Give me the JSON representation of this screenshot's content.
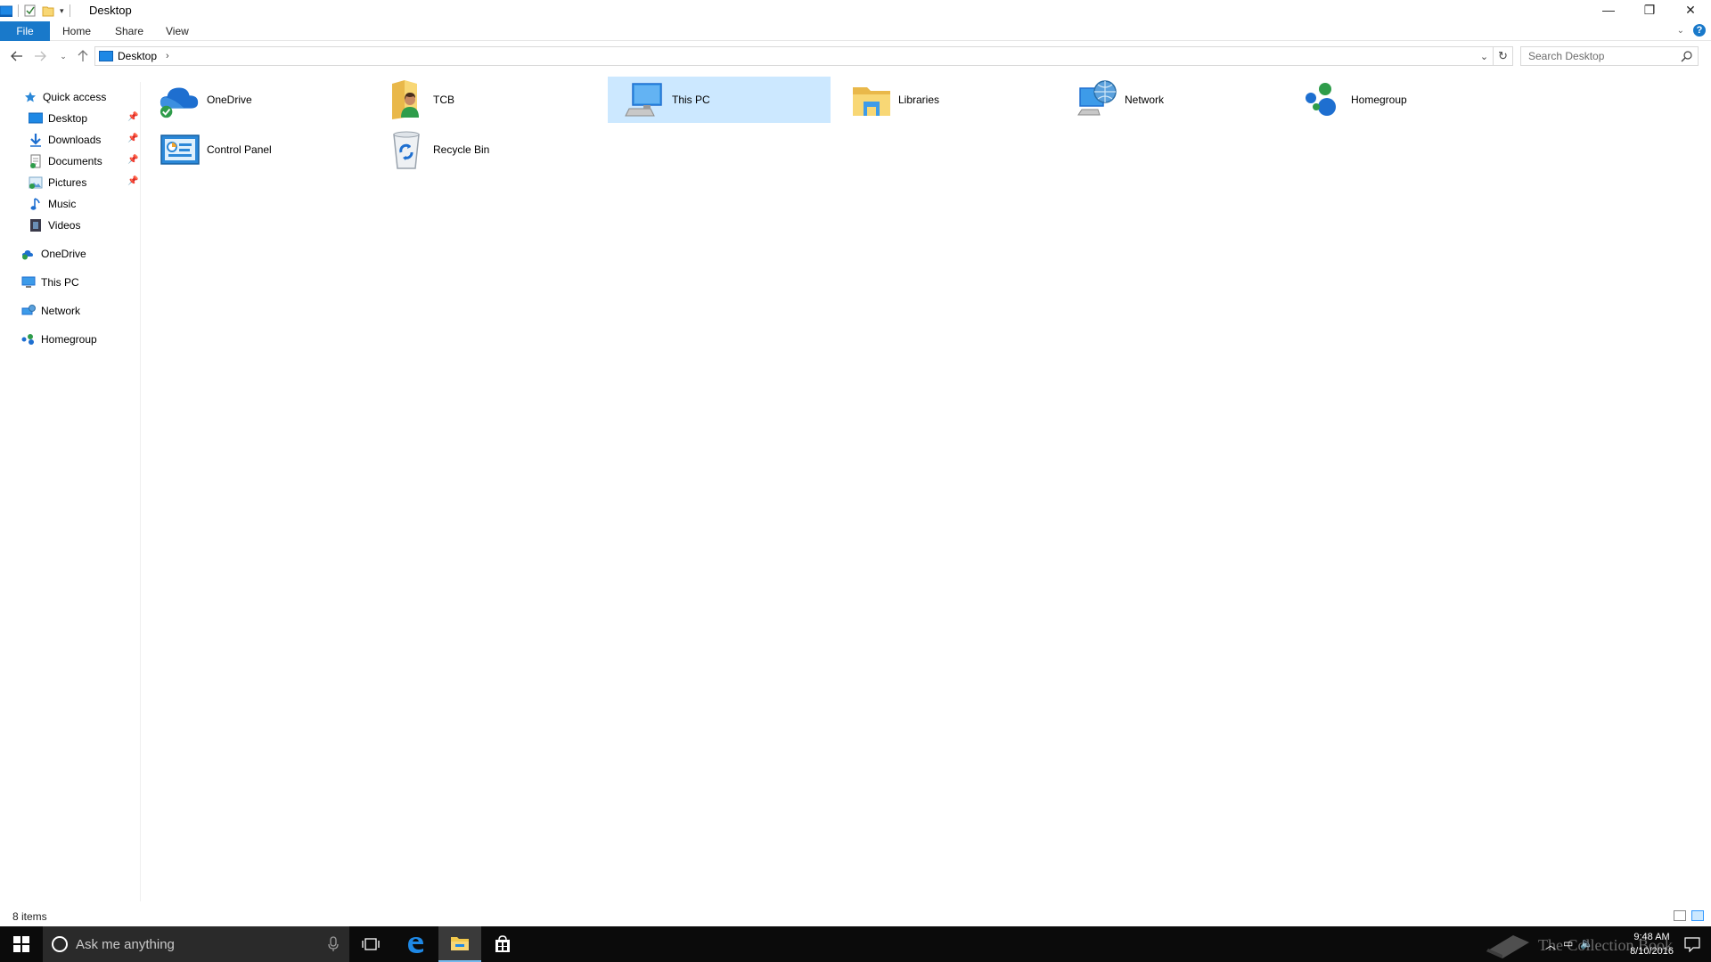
{
  "window": {
    "title": "Desktop",
    "controls": {
      "minimize": "—",
      "restore": "❐",
      "close": "✕"
    }
  },
  "ribbon": {
    "tabs": [
      {
        "label": "File"
      },
      {
        "label": "Home"
      },
      {
        "label": "Share"
      },
      {
        "label": "View"
      }
    ],
    "help": "?"
  },
  "address": {
    "location": "Desktop",
    "chevron": "›"
  },
  "search": {
    "placeholder": "Search Desktop"
  },
  "navpane": {
    "quick_access": "Quick access",
    "pinned": [
      {
        "label": "Desktop"
      },
      {
        "label": "Downloads"
      },
      {
        "label": "Documents"
      },
      {
        "label": "Pictures"
      }
    ],
    "unpinned": [
      {
        "label": "Music"
      },
      {
        "label": "Videos"
      }
    ],
    "roots": [
      {
        "label": "OneDrive"
      },
      {
        "label": "This PC"
      },
      {
        "label": "Network"
      },
      {
        "label": "Homegroup"
      }
    ]
  },
  "items": [
    {
      "label": "OneDrive",
      "icon": "onedrive-icon"
    },
    {
      "label": "TCB",
      "icon": "user-folder-icon"
    },
    {
      "label": "This PC",
      "icon": "this-pc-icon",
      "selected": true
    },
    {
      "label": "Libraries",
      "icon": "libraries-icon"
    },
    {
      "label": "Network",
      "icon": "network-icon"
    },
    {
      "label": "Homegroup",
      "icon": "homegroup-icon"
    },
    {
      "label": "Control Panel",
      "icon": "control-panel-icon"
    },
    {
      "label": "Recycle Bin",
      "icon": "recycle-bin-icon"
    }
  ],
  "status": {
    "count": "8 items"
  },
  "taskbar": {
    "search_placeholder": "Ask me anything",
    "watermark": "The Collection Book",
    "time": "9:48 AM",
    "date": "8/10/2016"
  },
  "colors": {
    "accent": "#1979ca",
    "selection": "#cce8ff",
    "taskbar": "#0b0b0b"
  }
}
